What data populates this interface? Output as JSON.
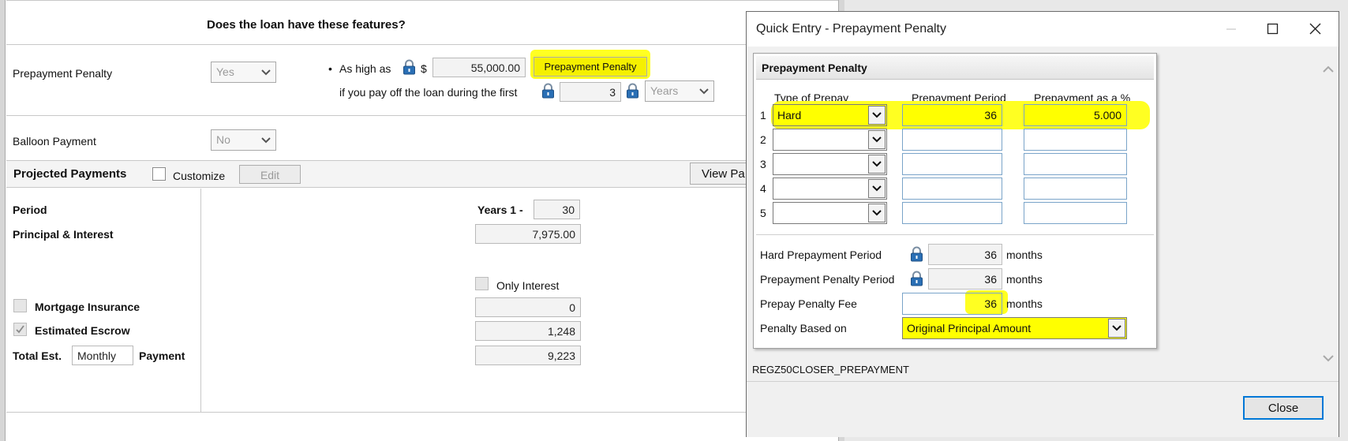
{
  "background_form": {
    "features_heading": "Does the loan have these features?",
    "prepayment_penalty": {
      "label": "Prepayment Penalty",
      "select_value": "Yes",
      "bullet": "•",
      "as_high_as_label": "As high as",
      "currency_symbol": "$",
      "amount": "55,000.00",
      "button_label": "Prepayment Penalty",
      "payoff_label": "if you pay off the loan during the first",
      "period_value": "3",
      "period_unit": "Years"
    },
    "balloon_payment": {
      "label": "Balloon Payment",
      "select_value": "No"
    },
    "projected_payments": {
      "title": "Projected Payments",
      "customize_label": "Customize",
      "edit_button": "Edit",
      "view_button": "View Pa"
    },
    "grid": {
      "period_label": "Period",
      "years_label": "Years 1 -",
      "years_value": "30",
      "pi_label": "Principal & Interest",
      "pi_value": "7,975.00",
      "only_interest_label": "Only Interest",
      "mortgage_insurance_label": "Mortgage Insurance",
      "mortgage_insurance_value": "0",
      "estimated_escrow_label": "Estimated Escrow",
      "estimated_escrow_value": "1,248",
      "total_label": "Total Est.",
      "total_frequency": "Monthly",
      "payment_label": "Payment",
      "total_value": "9,223"
    }
  },
  "dialog": {
    "title": "Quick Entry - Prepayment Penalty",
    "panel_title": "Prepayment Penalty",
    "columns": [
      "Type of Prepay",
      "Prepayment Period",
      "Prepayment as a %"
    ],
    "rows": [
      {
        "num": "1",
        "type": "Hard",
        "period": "36",
        "percent": "5.000"
      },
      {
        "num": "2",
        "type": "",
        "period": "",
        "percent": ""
      },
      {
        "num": "3",
        "type": "",
        "period": "",
        "percent": ""
      },
      {
        "num": "4",
        "type": "",
        "period": "",
        "percent": ""
      },
      {
        "num": "5",
        "type": "",
        "period": "",
        "percent": ""
      }
    ],
    "hard_period_label": "Hard Prepayment Period",
    "hard_period_value": "36",
    "penalty_period_label": "Prepayment Penalty Period",
    "penalty_period_value": "36",
    "fee_label": "Prepay Penalty Fee",
    "fee_value": "36",
    "months_label": "months",
    "based_on_label": "Penalty Based on",
    "based_on_value": "Original Principal Amount",
    "form_id": "REGZ50CLOSER_PREPAYMENT",
    "close_button": "Close"
  },
  "colors": {
    "highlight": "#ffff00",
    "lock_blue": "#2a6fb5"
  }
}
